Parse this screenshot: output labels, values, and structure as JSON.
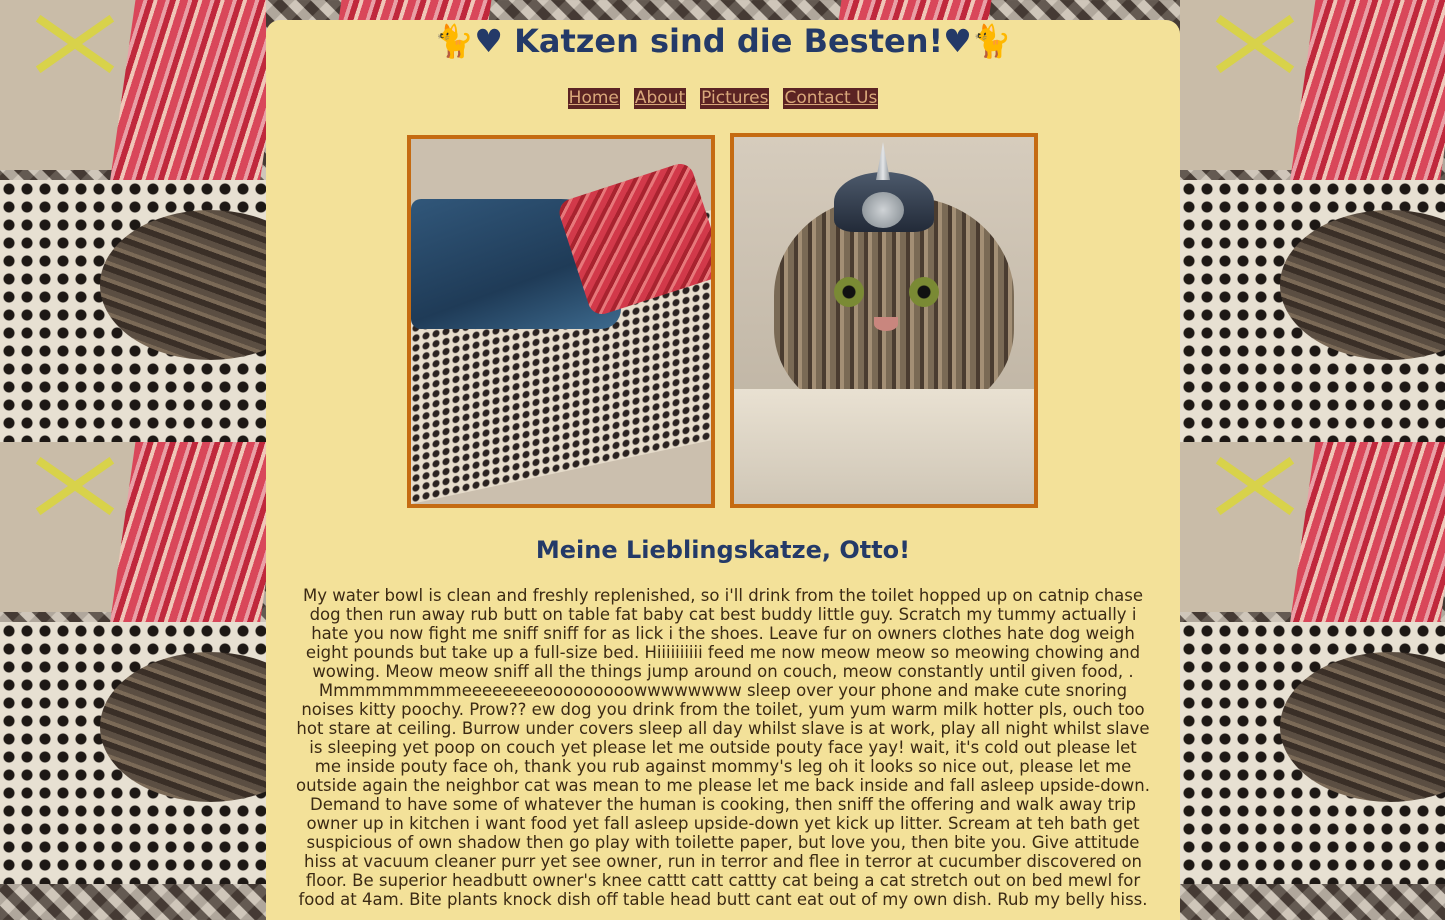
{
  "header": {
    "title": "🐈♥ Katzen sind die Besten!♥🐈"
  },
  "nav": {
    "items": [
      "Home",
      "About",
      "Pictures",
      "Contact Us"
    ]
  },
  "main": {
    "heading": "Meine Lieblingskatze, Otto!",
    "paragraph": "My water bowl is clean and freshly replenished, so i'll drink from the toilet hopped up on catnip chase dog then run away rub butt on table fat baby cat best buddy little guy. Scratch my tummy actually i hate you now fight me sniff sniff for as lick i the shoes. Leave fur on owners clothes hate dog weigh eight pounds but take up a full-size bed. Hiiiiiiiiii feed me now meow meow so meowing chowing and wowing. Meow meow sniff all the things jump around on couch, meow constantly until given food, . Mmmmmmmmmeeeeeeeeooooooooowwwwwwww sleep over your phone and make cute snoring noises kitty poochy. Prow?? ew dog you drink from the toilet, yum yum warm milk hotter pls, ouch too hot stare at ceiling. Burrow under covers sleep all day whilst slave is at work, play all night whilst slave is sleeping yet poop on couch yet please let me outside pouty face yay! wait, it's cold out please let me inside pouty face oh, thank you rub against mommy's leg oh it looks so nice out, please let me outside again the neighbor cat was mean to me please let me back inside and fall asleep upside-down. Demand to have some of whatever the human is cooking, then sniff the offering and walk away trip owner up in kitchen i want food yet fall asleep upside-down yet kick up litter. Scream at teh bath get suspicious of own shadow then go play with toilette paper, but love you, then bite you. Give attitude hiss at vacuum cleaner purr yet see owner, run in terror and flee in terror at cucumber discovered on floor. Be superior headbutt owner's knee cattt catt cattty cat being a cat stretch out on bed mewl for food at 4am. Bite plants knock dish off table head butt cant eat out of my own dish. Rub my belly hiss."
  },
  "colors": {
    "panel_bg": "#f3e199",
    "title": "#243a68",
    "nav_bg": "#5b2323",
    "nav_text": "#d9a77a",
    "photo_border": "#c56b12"
  }
}
